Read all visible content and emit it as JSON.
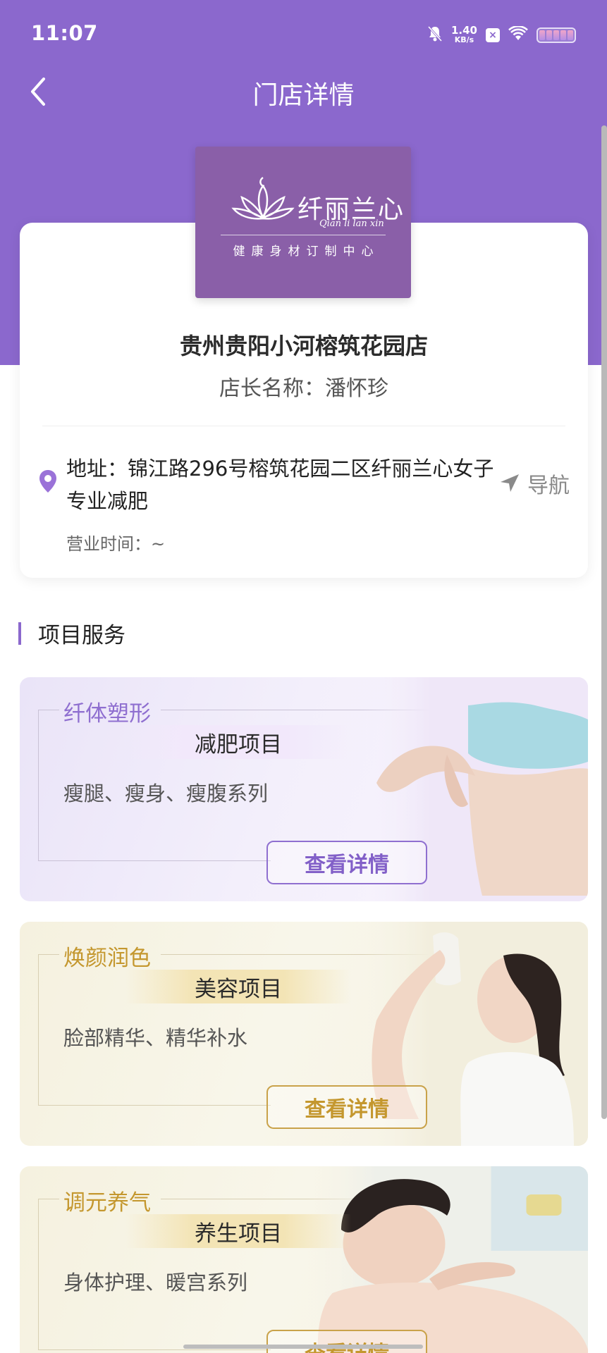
{
  "status_bar": {
    "time": "11:07",
    "net_speed_value": "1.40",
    "net_speed_unit": "KB/s",
    "notification_badge": "×",
    "icons": [
      "mute-bell-icon",
      "close-badge-icon",
      "wifi-icon",
      "battery-icon"
    ]
  },
  "header": {
    "title": "门店详情",
    "back_icon": "chevron-left-icon"
  },
  "colors": {
    "primary": "#8b68cd",
    "gold": "#c4972e",
    "logo_bg": "#8a5fa8"
  },
  "store": {
    "logo": {
      "brand": "纤丽兰心",
      "pinyin": "Qian li lan xin",
      "slogan": "健康身材订制中心"
    },
    "name": "贵州贵阳小河榕筑花园店",
    "manager": "店长名称：潘怀珍",
    "address": "地址：锦江路296号榕筑花园二区纤丽兰心女子专业减肥",
    "navigate_label": "导航",
    "hours": "营业时间：~"
  },
  "section": {
    "title": "项目服务"
  },
  "services": [
    {
      "subtitle": "纤体塑形",
      "label": "减肥项目",
      "description": "瘦腿、瘦身、瘦腹系列",
      "button": "查看详情"
    },
    {
      "subtitle": "焕颜润色",
      "label": "美容项目",
      "description": "脸部精华、精华补水",
      "button": "查看详情"
    },
    {
      "subtitle": "调元养气",
      "label": "养生项目",
      "description": "身体护理、暖宫系列",
      "button": "查看详情"
    }
  ]
}
